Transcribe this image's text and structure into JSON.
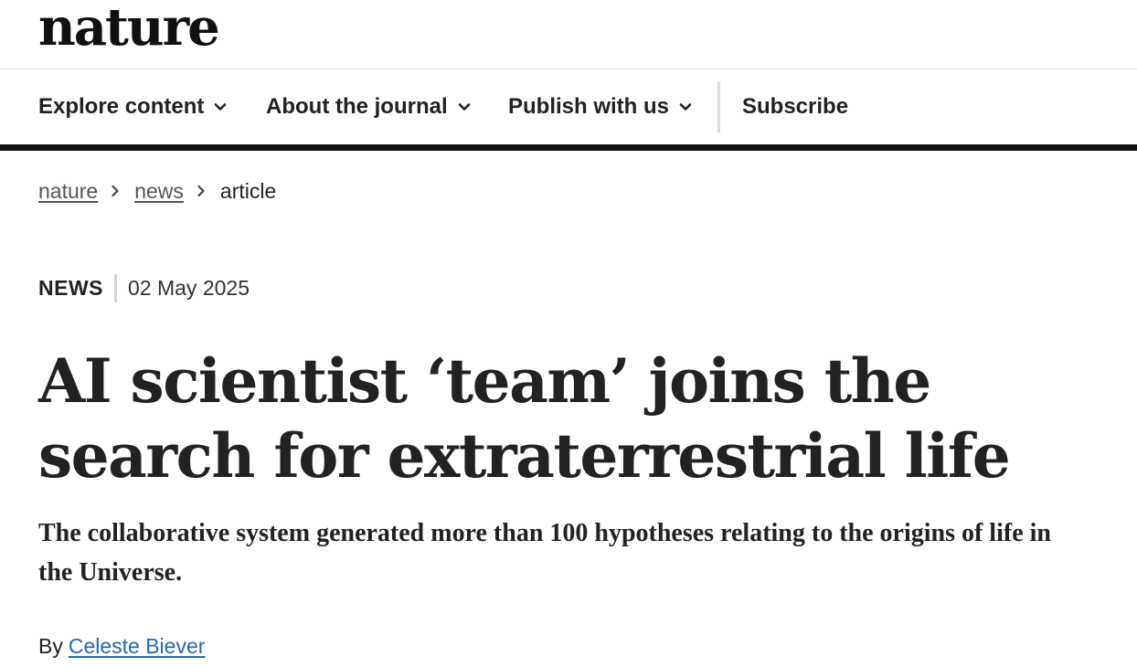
{
  "brand": {
    "logo_text": "nature"
  },
  "nav": {
    "items": [
      {
        "label": "Explore content",
        "icon": "chevron-down-icon"
      },
      {
        "label": "About the journal",
        "icon": "chevron-down-icon"
      },
      {
        "label": "Publish with us",
        "icon": "chevron-down-icon"
      }
    ],
    "subscribe_label": "Subscribe"
  },
  "breadcrumb": {
    "items": [
      "nature",
      "news"
    ],
    "current": "article",
    "separator_icon": "chevron-right-icon"
  },
  "article": {
    "type": "NEWS",
    "date": "02 May 2025",
    "title": "AI scientist ‘team’ joins the search for extraterrestrial life",
    "standfirst": "The collaborative system generated more than 100 hypotheses relating to the origins of life in the Universe.",
    "byline_prefix": "By",
    "author": "Celeste Biever"
  },
  "colors": {
    "text": "#222222",
    "link_author": "#1f6ab3",
    "rule": "#111111"
  }
}
